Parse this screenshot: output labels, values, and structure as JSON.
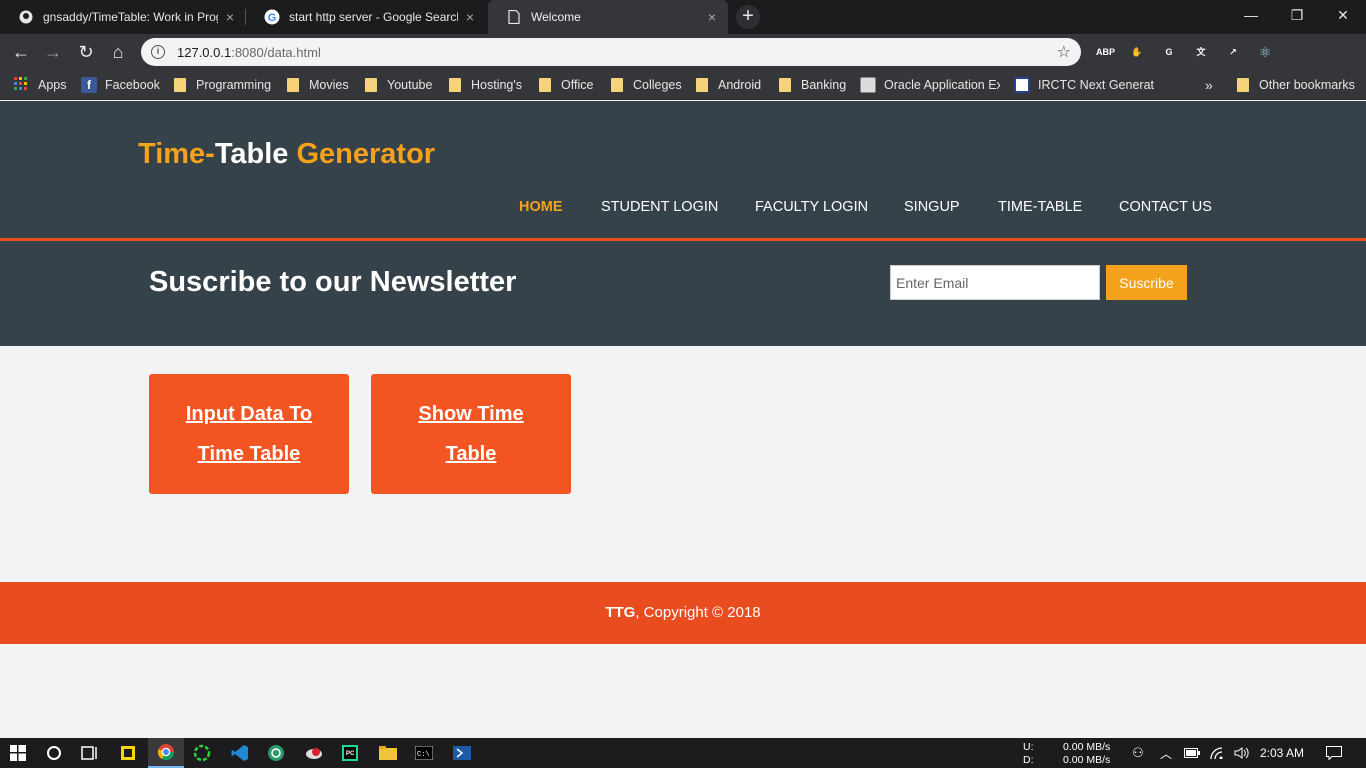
{
  "browser": {
    "tabs": [
      {
        "title": "gnsaddy/TimeTable: Work in Prog",
        "icon": "github-icon",
        "active": false
      },
      {
        "title": "start http server - Google Search",
        "icon": "google-icon",
        "active": false
      },
      {
        "title": "Welcome",
        "icon": "page-icon",
        "active": true
      }
    ],
    "tab_close": "×",
    "new_tab": "+",
    "window_controls": {
      "minimize": "—",
      "maximize": "❐",
      "close": "✕"
    },
    "nav": {
      "back": "←",
      "forward": "→",
      "reload": "↻",
      "home": "⌂"
    },
    "url_host": "127.0.0.1",
    "url_rest": ":8080/data.html",
    "extensions": [
      {
        "icon": "adblock-plus-icon",
        "label": "ABP",
        "color": "#d8232a"
      },
      {
        "icon": "stop-hand-icon",
        "label": "✋",
        "color": "#d8232a"
      },
      {
        "icon": "grammarly-icon",
        "label": "G",
        "color": "#15c39a"
      },
      {
        "icon": "google-translate-icon",
        "label": "文",
        "color": "#4a8af4"
      },
      {
        "icon": "arrow-extension-icon",
        "label": "↗",
        "color": "#d8232a"
      },
      {
        "icon": "react-devtools-icon",
        "label": "⚛",
        "color": "#35363a"
      },
      {
        "icon": "profile-avatar-icon",
        "label": "",
        "color": "#9a8f84"
      }
    ],
    "bookmarks": [
      {
        "label": "Apps",
        "icon": "apps-grid-icon"
      },
      {
        "label": "Facebook",
        "icon": "facebook-icon"
      },
      {
        "label": "Programming",
        "icon": "folder-icon"
      },
      {
        "label": "Movies",
        "icon": "folder-icon"
      },
      {
        "label": "Youtube",
        "icon": "folder-icon"
      },
      {
        "label": "Hosting's",
        "icon": "folder-icon"
      },
      {
        "label": "Office",
        "icon": "folder-icon"
      },
      {
        "label": "Colleges",
        "icon": "folder-icon"
      },
      {
        "label": "Android",
        "icon": "folder-icon"
      },
      {
        "label": "Banking",
        "icon": "folder-icon"
      },
      {
        "label": "Oracle Application Ex",
        "icon": "oracle-page-icon"
      },
      {
        "label": "IRCTC Next Generatio",
        "icon": "irctc-icon"
      }
    ],
    "bookmarks_more": "»",
    "other_bookmarks": "Other bookmarks"
  },
  "site": {
    "logo": {
      "part1": "Time-",
      "part2": "Table ",
      "part3": "Generator"
    },
    "nav": [
      "HOME",
      "STUDENT LOGIN",
      "FACULTY LOGIN",
      "SINGUP",
      "TIME-TABLE",
      "CONTACT US"
    ],
    "accent_color": "#f4a11b",
    "header_color": "#35424a",
    "orange_color": "#e84c1f",
    "newsletter": {
      "title": "Suscribe to our Newsletter",
      "email_placeholder": "Enter Email",
      "button": "Suscribe"
    },
    "cards": [
      {
        "label": "Input Data To Time Table"
      },
      {
        "label": "Show Time Table"
      }
    ],
    "footer": {
      "brand": "TTG",
      "text": ", Copyright © 2018"
    }
  },
  "taskbar": {
    "net_upload_label": "U:",
    "net_download_label": "D:",
    "net_upload": "0.00 MB/s",
    "net_download": "0.00 MB/s",
    "time": "2:03 AM"
  }
}
